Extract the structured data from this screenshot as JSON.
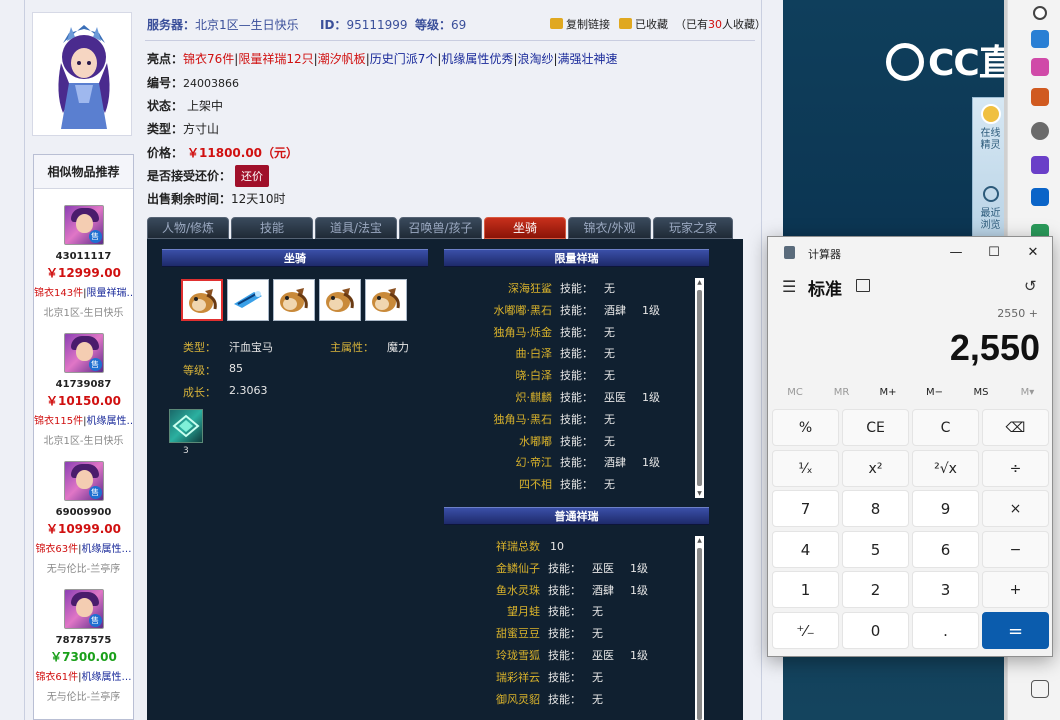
{
  "listing": {
    "server_label": "服务器：",
    "server_value": "北京1区—生日快乐",
    "id_label": "ID：",
    "id_value": "95111999",
    "level_label": "等级：",
    "level_value": "69",
    "copy_link": "复制链接",
    "favorited": "已收藏",
    "fav_count_prefix": "（已有",
    "fav_count": "30",
    "fav_count_suffix": "人收藏）",
    "highlights_label": "亮点：",
    "highlights": [
      {
        "text": "锦衣76件",
        "color": "red"
      },
      {
        "text": "限量祥瑞12只",
        "color": "red"
      },
      {
        "text": "潮汐帆板",
        "color": "red"
      },
      {
        "text": "历史门派7个",
        "color": "blue"
      },
      {
        "text": "机缘属性优秀",
        "color": "blue"
      },
      {
        "text": "浪淘纱",
        "color": "blue"
      },
      {
        "text": "满强壮神速",
        "color": "blue"
      }
    ],
    "number_label": "编号：",
    "number_value": "24003866",
    "status_label": "状态：",
    "status_value": "上架中",
    "type_label": "类型：",
    "type_value": "方寸山",
    "price_label": "价格：",
    "price_value": "￥11800.00（元）",
    "bargain_label": "是否接受还价：",
    "bargain_button": "还价",
    "time_label": "出售剩余时间：",
    "time_value": "12天10时"
  },
  "similar": {
    "title": "相似物品推荐",
    "sell_badge": "售",
    "items": [
      {
        "id": "43011117",
        "price": "￥12999.00",
        "price_color": "#d01010",
        "tag1": "锦衣143件",
        "tag2": "限量祥瑞…",
        "server": "北京1区-生日快乐"
      },
      {
        "id": "41739087",
        "price": "￥10150.00",
        "price_color": "#d01010",
        "tag1": "锦衣115件",
        "tag2": "机缘属性…",
        "server": "北京1区-生日快乐"
      },
      {
        "id": "69009900",
        "price": "￥10999.00",
        "price_color": "#d01010",
        "tag1": "锦衣63件",
        "tag2": "机缘属性…",
        "server": "无与伦比-兰亭序"
      },
      {
        "id": "78787575",
        "price": "￥7300.00",
        "price_color": "#1aa01a",
        "tag1": "锦衣61件",
        "tag2": "机缘属性…",
        "server": "无与伦比-兰亭序"
      }
    ]
  },
  "tabs": [
    {
      "label": "人物/修炼",
      "active": false
    },
    {
      "label": "技能",
      "active": false
    },
    {
      "label": "道具/法宝",
      "active": false
    },
    {
      "label": "召唤兽/孩子",
      "active": false
    },
    {
      "label": "坐骑",
      "active": true
    },
    {
      "label": "锦衣/外观",
      "active": false
    },
    {
      "label": "玩家之家",
      "active": false
    }
  ],
  "mount_panel": {
    "title": "坐骑",
    "type_label": "类型：",
    "type_value": "汗血宝马",
    "attr_label": "主属性：",
    "attr_value": "魔力",
    "level_label": "等级：",
    "level_value": "85",
    "growth_label": "成长：",
    "growth_value": "2.3063",
    "skill_count": "3"
  },
  "limited_panel": {
    "title": "限量祥瑞",
    "skill_label": "技能：",
    "rows": [
      {
        "name": "深海狂鲨",
        "skill": "无",
        "level": ""
      },
      {
        "name": "水嘟嘟·黑石",
        "skill": "酒肆",
        "level": "1级"
      },
      {
        "name": "独角马·烁金",
        "skill": "无",
        "level": ""
      },
      {
        "name": "曲·白泽",
        "skill": "无",
        "level": ""
      },
      {
        "name": "晓·白泽",
        "skill": "无",
        "level": ""
      },
      {
        "name": "炽·麒麟",
        "skill": "巫医",
        "level": "1级"
      },
      {
        "name": "独角马·黑石",
        "skill": "无",
        "level": ""
      },
      {
        "name": "水嘟嘟",
        "skill": "无",
        "level": ""
      },
      {
        "name": "幻·帝江",
        "skill": "酒肆",
        "level": "1级"
      },
      {
        "name": "四不相",
        "skill": "无",
        "level": ""
      }
    ]
  },
  "normal_panel": {
    "title": "普通祥瑞",
    "total_label": "祥瑞总数",
    "total_value": "10",
    "skill_label": "技能：",
    "rows": [
      {
        "name": "金鳞仙子",
        "skill": "巫医",
        "level": "1级"
      },
      {
        "name": "鱼水灵珠",
        "skill": "酒肆",
        "level": "1级"
      },
      {
        "name": "望月蛙",
        "skill": "无",
        "level": ""
      },
      {
        "name": "甜蜜豆豆",
        "skill": "无",
        "level": ""
      },
      {
        "name": "玲珑雪狐",
        "skill": "巫医",
        "level": "1级"
      },
      {
        "name": "瑞彩祥云",
        "skill": "无",
        "level": ""
      },
      {
        "name": "御风灵貂",
        "skill": "无",
        "level": ""
      }
    ]
  },
  "side_widget": {
    "service_label": "在线精灵",
    "recent_label": "最近浏览"
  },
  "brand": {
    "logo_text": "CC直播"
  },
  "calculator": {
    "title": "计算器",
    "mode": "标准",
    "expression": "2550 +",
    "display": "2,550",
    "memory": [
      "MC",
      "MR",
      "M+",
      "M−",
      "MS",
      "M▾"
    ],
    "keys": [
      [
        "%",
        "CE",
        "C",
        "⌫"
      ],
      [
        "¹⁄ₓ",
        "x²",
        "²√x",
        "÷"
      ],
      [
        "7",
        "8",
        "9",
        "×"
      ],
      [
        "4",
        "5",
        "6",
        "−"
      ],
      [
        "1",
        "2",
        "3",
        "+"
      ],
      [
        "⁺⁄₋",
        "0",
        ".",
        "="
      ]
    ],
    "minimize": "—",
    "maximize": "☐",
    "close": "✕",
    "menu_icon": "☰",
    "history_icon": "↺"
  },
  "colors": {
    "panel_bg": "#102030",
    "item_name": "#d9b22b",
    "calc_equals": "#0b5cad"
  }
}
